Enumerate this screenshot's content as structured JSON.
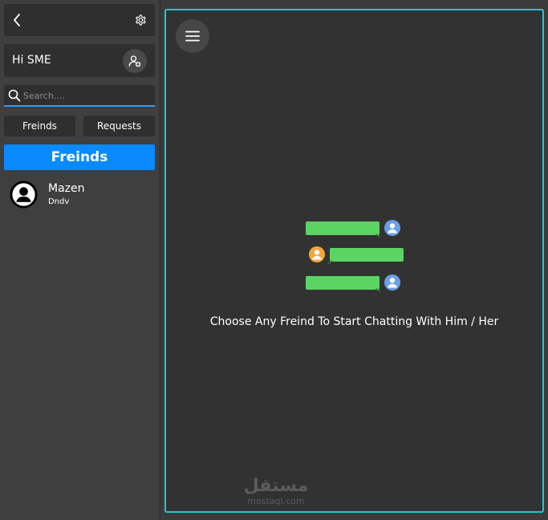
{
  "sidebar": {
    "greeting": "Hi SME",
    "search": {
      "placeholder": "Search....",
      "value": ""
    },
    "tabs": {
      "friends": "Freinds",
      "requests": "Requests"
    },
    "section_title": "Freinds",
    "friends": [
      {
        "name": "Mazen",
        "status": "Dndv"
      }
    ]
  },
  "main": {
    "empty_message": "Choose Any Freind To Start Chatting With Him / Her",
    "watermark": {
      "arabic": "مستقل",
      "latin": "mostaql.com"
    }
  },
  "colors": {
    "accent": "#0a8aff",
    "panel_border": "#1fc9d6",
    "bubble_green": "#5bd463",
    "avatar_blue": "#6b9fe6",
    "avatar_orange": "#f4a63a"
  },
  "icons": {
    "back": "chevron-left-icon",
    "settings": "gear-icon",
    "add_user": "add-user-icon",
    "search": "search-icon",
    "avatar": "user-circle-icon",
    "menu": "hamburger-menu-icon"
  }
}
